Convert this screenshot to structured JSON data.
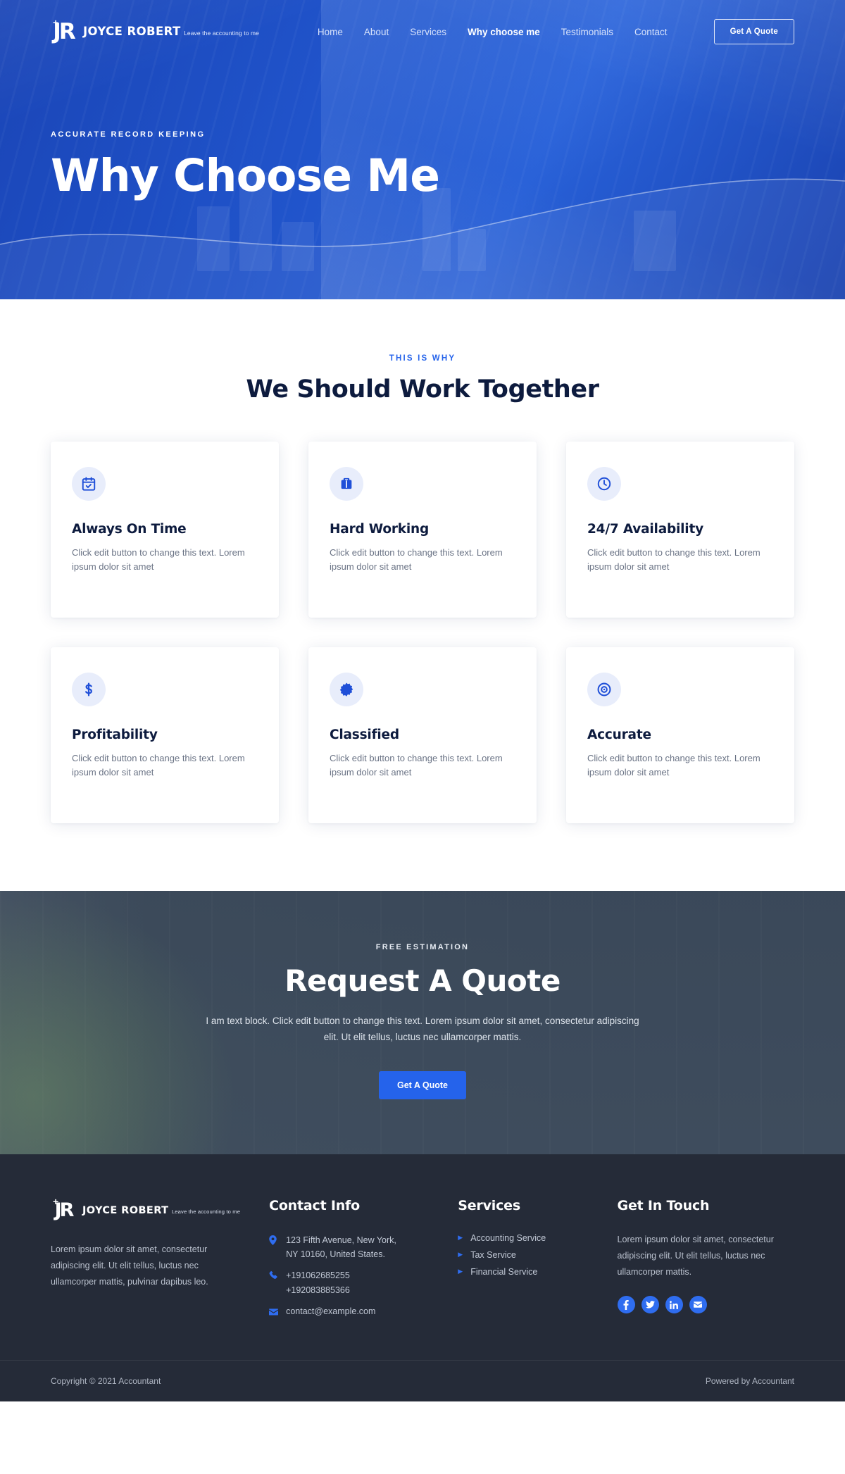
{
  "brand": {
    "name": "JOYCE ROBERT",
    "tagline": "Leave the accounting to me",
    "monogram": "JR",
    "accent": "#2563eb",
    "navy": "#0d1b3e",
    "footer_bg": "#252b38"
  },
  "nav": {
    "items": [
      {
        "label": "Home",
        "active": false
      },
      {
        "label": "About",
        "active": false
      },
      {
        "label": "Services",
        "active": false
      },
      {
        "label": "Why choose me",
        "active": true
      },
      {
        "label": "Testimonials",
        "active": false
      },
      {
        "label": "Contact",
        "active": false
      }
    ],
    "cta_label": "Get A Quote"
  },
  "hero": {
    "eyebrow": "ACCURATE RECORD KEEPING",
    "title": "Why Choose Me"
  },
  "features": {
    "eyebrow": "THIS IS WHY",
    "title": "We Should Work Together",
    "cards": [
      {
        "icon": "calendar-check-icon",
        "title": "Always On Time",
        "text": "Click edit button to change this text. Lorem ipsum dolor sit amet"
      },
      {
        "icon": "briefcase-icon",
        "title": "Hard Working",
        "text": "Click edit button to change this text. Lorem ipsum dolor sit amet"
      },
      {
        "icon": "clock-icon",
        "title": "24/7 Availability",
        "text": "Click edit button to change this text. Lorem ipsum dolor sit amet"
      },
      {
        "icon": "dollar-icon",
        "title": "Profitability",
        "text": "Click edit button to change this text. Lorem ipsum dolor sit amet"
      },
      {
        "icon": "badge-starburst-icon",
        "title": "Classified",
        "text": "Click edit button to change this text. Lorem ipsum dolor sit amet"
      },
      {
        "icon": "target-icon",
        "title": "Accurate",
        "text": "Click edit button to change this text. Lorem ipsum dolor sit amet"
      }
    ]
  },
  "cta": {
    "eyebrow": "FREE ESTIMATION",
    "title": "Request A Quote",
    "text": "I am text block. Click edit button to change this text. Lorem ipsum dolor sit amet, consectetur adipiscing elit. Ut elit tellus, luctus nec ullamcorper mattis.",
    "button_label": "Get A Quote"
  },
  "footer": {
    "about_text": "Lorem ipsum dolor sit amet, consectetur adipiscing elit. Ut elit tellus, luctus nec ullamcorper mattis, pulvinar dapibus leo.",
    "contact": {
      "heading": "Contact Info",
      "address_line1": "123 Fifth Avenue, New York,",
      "address_line2": "NY 10160, United States.",
      "phone1": "+191062685255",
      "phone2": "+192083885366",
      "email": "contact@example.com"
    },
    "services": {
      "heading": "Services",
      "items": [
        "Accounting Service",
        "Tax Service",
        "Financial Service"
      ]
    },
    "touch": {
      "heading": "Get In Touch",
      "text": "Lorem ipsum dolor sit amet, consectetur adipiscing elit. Ut elit tellus, luctus nec ullamcorper mattis.",
      "socials": [
        "facebook-icon",
        "twitter-icon",
        "linkedin-icon",
        "email-icon"
      ]
    },
    "copyright": "Copyright © 2021 Accountant",
    "powered_by": "Powered by Accountant"
  }
}
